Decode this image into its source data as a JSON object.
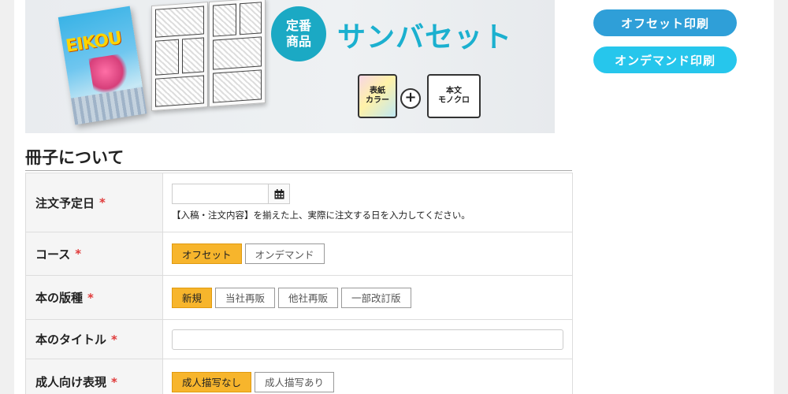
{
  "banner": {
    "cover_title": "EIKOU",
    "badge_line1": "定番",
    "badge_line2": "商品",
    "headline": "サンバセット",
    "cover_icon_line1": "表紙",
    "cover_icon_line2": "カラー",
    "plus": "+",
    "body_icon_line1": "本文",
    "body_icon_line2": "モノクロ",
    "colors": {
      "badge": "#1ba9c4",
      "headline": "#1bb0cf"
    }
  },
  "side_buttons": {
    "offset_label": "オフセット印刷",
    "ondemand_label": "オンデマンド印刷",
    "colors": {
      "offset": "#2f9fd8",
      "ondemand": "#26c6ec"
    }
  },
  "section": {
    "title": "冊子について"
  },
  "form": {
    "required_mark": "*",
    "order_date": {
      "label": "注文予定日",
      "value": "",
      "placeholder": "",
      "calendar_icon": "calendar-icon",
      "hint": "【入稿・注文内容】を揃えた上、実際に注文する日を入力してください。"
    },
    "course": {
      "label": "コース",
      "options": [
        "オフセット",
        "オンデマンド"
      ],
      "selected": "オフセット"
    },
    "edition": {
      "label": "本の版種",
      "options": [
        "新規",
        "当社再販",
        "他社再販",
        "一部改訂版"
      ],
      "selected": "新規"
    },
    "book_title": {
      "label": "本のタイトル",
      "value": "",
      "placeholder": ""
    },
    "adult": {
      "label": "成人向け表現",
      "options": [
        "成人描写なし",
        "成人描写あり"
      ],
      "selected": "成人描写なし"
    },
    "colors": {
      "selected": "#f7b52c",
      "required": "#e03a3a"
    }
  }
}
